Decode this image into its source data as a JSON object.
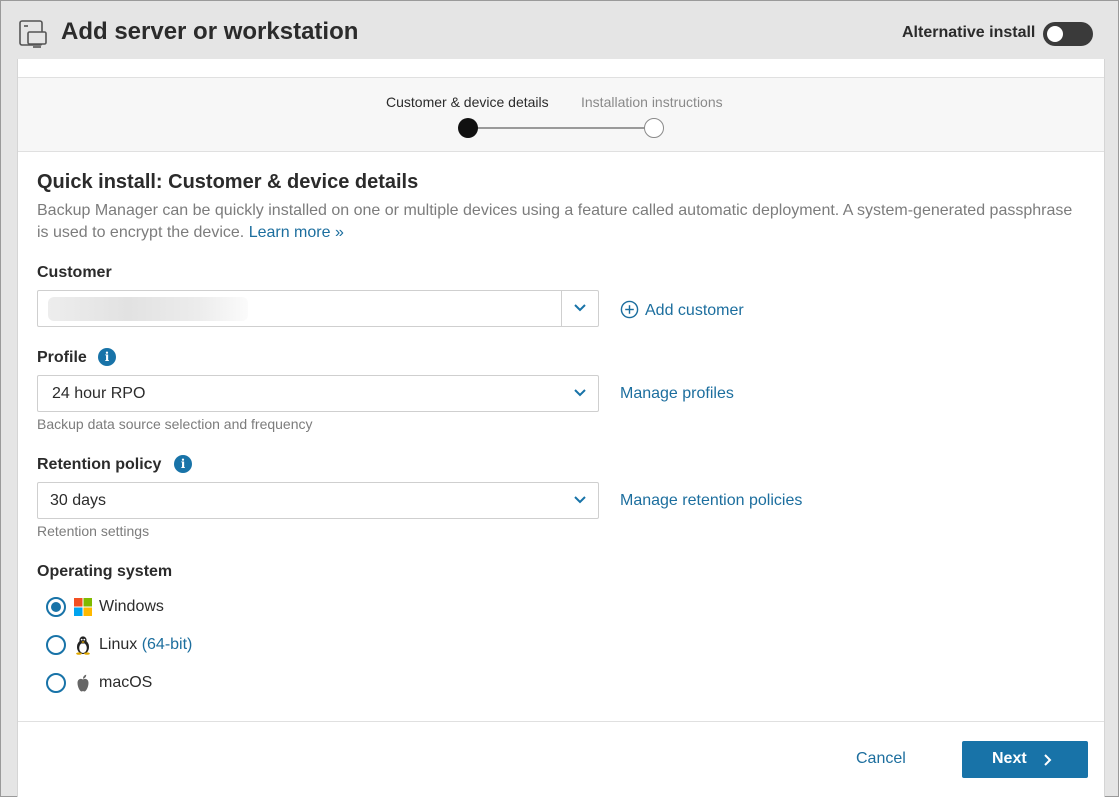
{
  "header": {
    "title": "Add server or workstation",
    "icon": "server-workstation-icon",
    "alternative_install_label": "Alternative install",
    "alternative_install_on": false
  },
  "stepper": {
    "steps": [
      {
        "label": "Customer & device details",
        "active": true
      },
      {
        "label": "Installation instructions",
        "active": false
      }
    ]
  },
  "section": {
    "title": "Quick install: Customer & device details",
    "description": "Backup Manager can be quickly installed on one or multiple devices using a feature called automatic deployment. A system-generated passphrase is used to encrypt the device.",
    "learn_more": "Learn more »"
  },
  "customer": {
    "label": "Customer",
    "value": "",
    "add_link": "Add customer"
  },
  "profile": {
    "label": "Profile",
    "value": "24 hour RPO",
    "hint": "Backup data source selection and frequency",
    "manage_link": "Manage profiles"
  },
  "retention": {
    "label": "Retention policy",
    "value": "30 days",
    "hint": "Retention settings",
    "manage_link": "Manage retention policies"
  },
  "os": {
    "label": "Operating system",
    "options": [
      {
        "label": "Windows",
        "extra": "",
        "checked": true,
        "icon": "windows-icon"
      },
      {
        "label": "Linux",
        "extra": "(64-bit)",
        "checked": false,
        "icon": "linux-icon"
      },
      {
        "label": "macOS",
        "extra": "",
        "checked": false,
        "icon": "apple-icon"
      }
    ]
  },
  "footer": {
    "cancel": "Cancel",
    "next": "Next"
  },
  "colors": {
    "accent": "#1873a8",
    "link": "#1c6e9e",
    "toggle_off": "#3a3a3a"
  }
}
